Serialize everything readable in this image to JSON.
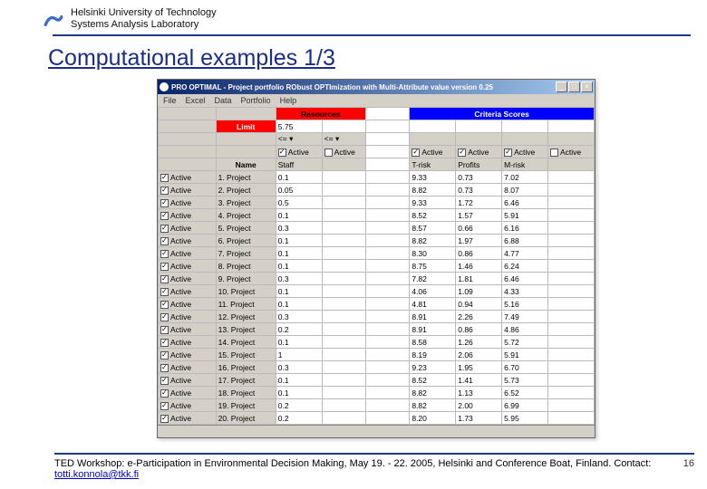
{
  "header": {
    "line1": "Helsinki University of Technology",
    "line2": "Systems Analysis Laboratory"
  },
  "title": "Computational examples 1/3",
  "app": {
    "title": "PRO OPTIMAL - Project portfolio RObust OPTImization with Multi-Attribute value   version 0.25",
    "menus": [
      "File",
      "Excel",
      "Data",
      "Portfolio",
      "Help"
    ],
    "resources_label": "Resources",
    "criteria_label": "Criteria Scores",
    "limit_label": "Limit",
    "limit_value": "5.75",
    "op1": "<=",
    "op2": "<=",
    "active_label": "Active",
    "name_label": "Name",
    "cols": [
      "Staff",
      "T-risk",
      "Profits",
      "M-risk"
    ],
    "col_active": [
      true,
      true,
      true,
      true,
      false
    ],
    "projects": [
      {
        "n": "1",
        "name": "Project",
        "staff": "0.1",
        "c1": "9.33",
        "c2": "0.73",
        "c3": "7.02"
      },
      {
        "n": "2",
        "name": "Project",
        "staff": "0.05",
        "c1": "8.82",
        "c2": "0.73",
        "c3": "8.07"
      },
      {
        "n": "3",
        "name": "Project",
        "staff": "0.5",
        "c1": "9.33",
        "c2": "1.72",
        "c3": "6.46"
      },
      {
        "n": "4",
        "name": "Project",
        "staff": "0.1",
        "c1": "8.52",
        "c2": "1.57",
        "c3": "5.91"
      },
      {
        "n": "5",
        "name": "Project",
        "staff": "0.3",
        "c1": "8.57",
        "c2": "0.66",
        "c3": "6.16"
      },
      {
        "n": "6",
        "name": "Project",
        "staff": "0.1",
        "c1": "8.82",
        "c2": "1.97",
        "c3": "6.88"
      },
      {
        "n": "7",
        "name": "Project",
        "staff": "0.1",
        "c1": "8.30",
        "c2": "0.86",
        "c3": "4.77"
      },
      {
        "n": "8",
        "name": "Project",
        "staff": "0.1",
        "c1": "8.75",
        "c2": "1.46",
        "c3": "6.24"
      },
      {
        "n": "9",
        "name": "Project",
        "staff": "0.3",
        "c1": "7.82",
        "c2": "1.81",
        "c3": "6.46"
      },
      {
        "n": "10",
        "name": "Project",
        "staff": "0.1",
        "c1": "4.06",
        "c2": "1.09",
        "c3": "4.33"
      },
      {
        "n": "11",
        "name": "Project",
        "staff": "0.1",
        "c1": "4.81",
        "c2": "0.94",
        "c3": "5.16"
      },
      {
        "n": "12",
        "name": "Project",
        "staff": "0.3",
        "c1": "8.91",
        "c2": "2.26",
        "c3": "7.49"
      },
      {
        "n": "13",
        "name": "Project",
        "staff": "0.2",
        "c1": "8.91",
        "c2": "0.86",
        "c3": "4.86"
      },
      {
        "n": "14",
        "name": "Project",
        "staff": "0.1",
        "c1": "8.58",
        "c2": "1.26",
        "c3": "5.72"
      },
      {
        "n": "15",
        "name": "Project",
        "staff": "1",
        "c1": "8.19",
        "c2": "2.06",
        "c3": "5.91"
      },
      {
        "n": "16",
        "name": "Project",
        "staff": "0.3",
        "c1": "9.23",
        "c2": "1.95",
        "c3": "6.70"
      },
      {
        "n": "17",
        "name": "Project",
        "staff": "0.1",
        "c1": "8.52",
        "c2": "1.41",
        "c3": "5.73"
      },
      {
        "n": "18",
        "name": "Project",
        "staff": "0.1",
        "c1": "8.82",
        "c2": "1.13",
        "c3": "6.52"
      },
      {
        "n": "19",
        "name": "Project",
        "staff": "0.2",
        "c1": "8.82",
        "c2": "2.00",
        "c3": "6.99"
      },
      {
        "n": "20",
        "name": "Project",
        "staff": "0.2",
        "c1": "8.20",
        "c2": "1.73",
        "c3": "5.95"
      }
    ]
  },
  "footer": {
    "text1": "TED Workshop: e-Participation in Environmental Decision Making, May 19. - 22. 2005, Helsinki and Conference Boat, Finland. Contact: ",
    "email": "totti.konnola@tkk.fi",
    "page": "16"
  }
}
